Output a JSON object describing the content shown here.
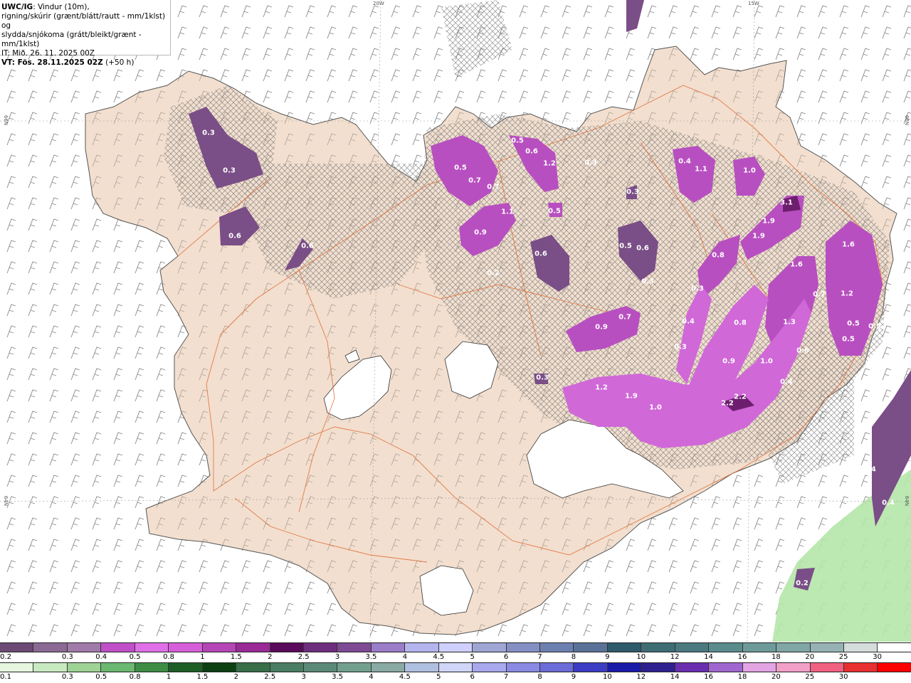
{
  "info": {
    "product": "UWC/IG",
    "line1_rest": ": Vindur (10m),",
    "line2": "rigning/skúrir (grænt/blátt/rautt - mm/1klst) og",
    "line3": "slydda/snjókoma (grátt/bleikt/grænt - mm/1klst)",
    "line4": "IT: Mið. 26. 11. 2025 00Z",
    "vt_label": "VT: Fös. 28.11.2025 02Z",
    "vt_offset": " (+50 h)"
  },
  "coords": {
    "lon20": "20W",
    "lon15": "15W",
    "lat66_left": "66N",
    "lat66_right": "66N",
    "lat64_left": "64N",
    "lat64_right": "64N"
  },
  "values": [
    "0.3",
    "0.3",
    "0.6",
    "0.6",
    "0.5",
    "0.7",
    "0.7",
    "0.9",
    "1.1",
    "0.5",
    "0.6",
    "1.2",
    "0.3",
    "0.5",
    "0.6",
    "0.4",
    "1.1",
    "1.0",
    "0.3",
    "0.5",
    "0.6",
    "0.3",
    "0.2",
    "3.1",
    "1.9",
    "1.9",
    "0.8",
    "1.6",
    "1.6",
    "1.2",
    "0.7",
    "0.3",
    "0.4",
    "0.8",
    "1.3",
    "0.5",
    "0.5",
    "0.5",
    "0.9",
    "0.7",
    "0.6",
    "0.3",
    "0.9",
    "1.0",
    "0.4",
    "0.3",
    "1.2",
    "1.9",
    "1.0",
    "2.2",
    "2.2",
    "0.4",
    "0.4",
    "0.4",
    "0.2"
  ],
  "snow_scale": {
    "labels": [
      "0.2",
      "0.3",
      "0.4",
      "0.5",
      "0.8",
      "1",
      "1.5",
      "2",
      "2.5",
      "3",
      "3.5",
      "4",
      "4.5",
      "5",
      "6",
      "7",
      "8",
      "9",
      "10",
      "12",
      "14",
      "16",
      "18",
      "20",
      "25",
      "30"
    ],
    "colors": [
      "#6b4a75",
      "#8a6a94",
      "#a07aa9",
      "#c04fc8",
      "#e070e8",
      "#d65fd9",
      "#b446b5",
      "#9a2a96",
      "#5a0a5a",
      "#6e2e7e",
      "#7e4a94",
      "#9a7cc8",
      "#b4b4ee",
      "#d0d0ff",
      "#9fa6d4",
      "#8490c4",
      "#6c80b0",
      "#5a7298",
      "#2f5a6a",
      "#3e6e74",
      "#4a7a80",
      "#5a8c8e",
      "#6e9a9a",
      "#80a6a6",
      "#96b2b4",
      "#d4dcdc",
      "#ffffff"
    ]
  },
  "rain_scale": {
    "labels": [
      "0.1",
      "0.3",
      "0.5",
      "0.8",
      "1",
      "1.5",
      "2",
      "2.5",
      "3",
      "3.5",
      "4",
      "4.5",
      "5",
      "6",
      "7",
      "8",
      "9",
      "10",
      "12",
      "14",
      "16",
      "18",
      "20",
      "25",
      "30"
    ],
    "colors": [
      "#e6f7df",
      "#c8eac0",
      "#9fd396",
      "#6bb870",
      "#3d8e44",
      "#1d5e26",
      "#0c4012",
      "#386e48",
      "#4a7e62",
      "#5c8a78",
      "#72a08e",
      "#8aaaa4",
      "#b0c0e0",
      "#cfd6f8",
      "#a8a8ee",
      "#8a8ae4",
      "#6c6cd8",
      "#3c3cc4",
      "#1a1aa8",
      "#2f2090",
      "#6a2eb0",
      "#a066d0",
      "#e3a4e4",
      "#f2a0c8",
      "#f06080",
      "#e83030",
      "#ff0000"
    ]
  }
}
